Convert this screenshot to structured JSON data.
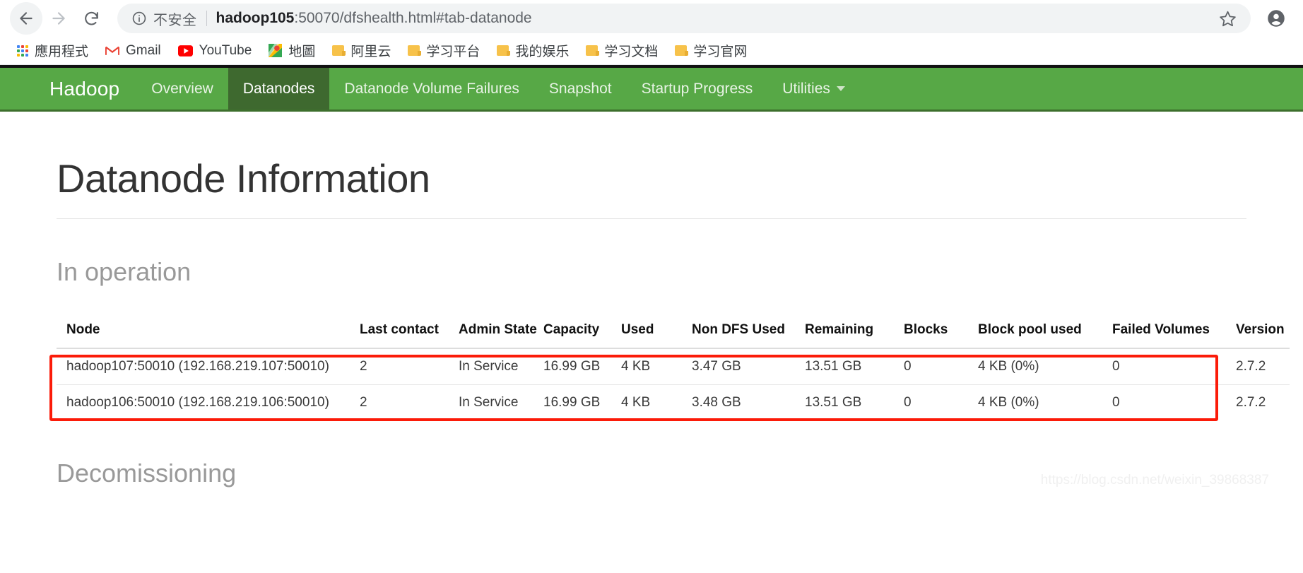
{
  "browser": {
    "back_icon": "arrow-left-icon",
    "forward_icon": "arrow-right-icon",
    "reload_icon": "reload-icon",
    "security_icon": "info-circle-icon",
    "security_label": "不安全",
    "url_host": "hadoop105",
    "url_rest": ":50070/dfshealth.html#tab-datanode",
    "star_icon": "star-icon",
    "profile_icon": "profile-avatar-icon",
    "bookmarks": [
      {
        "label": "應用程式",
        "icon": "apps-grid-icon"
      },
      {
        "label": "Gmail",
        "icon": "gmail-icon"
      },
      {
        "label": "YouTube",
        "icon": "youtube-icon"
      },
      {
        "label": "地圖",
        "icon": "google-maps-icon"
      },
      {
        "label": "阿里云",
        "icon": "folder-icon"
      },
      {
        "label": "学习平台",
        "icon": "folder-icon"
      },
      {
        "label": "我的娱乐",
        "icon": "folder-icon"
      },
      {
        "label": "学习文档",
        "icon": "folder-icon"
      },
      {
        "label": "学习官网",
        "icon": "folder-icon"
      }
    ]
  },
  "navbar": {
    "brand": "Hadoop",
    "accent_color": "#57a846",
    "active_color": "#3e692f",
    "items": [
      {
        "label": "Overview",
        "active": false
      },
      {
        "label": "Datanodes",
        "active": true
      },
      {
        "label": "Datanode Volume Failures",
        "active": false
      },
      {
        "label": "Snapshot",
        "active": false
      },
      {
        "label": "Startup Progress",
        "active": false
      },
      {
        "label": "Utilities",
        "active": false,
        "icon": "chevron-down-icon"
      }
    ]
  },
  "main": {
    "page_title": "Datanode Information",
    "in_operation_heading": "In operation",
    "decommissioning_heading": "Decomissioning",
    "highlight_color": "#fb1b09",
    "table": {
      "headers": [
        "Node",
        "Last contact",
        "Admin State",
        "Capacity",
        "Used",
        "Non DFS Used",
        "Remaining",
        "Blocks",
        "Block pool used",
        "Failed Volumes",
        "Version"
      ],
      "rows": [
        {
          "node": "hadoop107:50010 (192.168.219.107:50010)",
          "last_contact": "2",
          "admin_state": "In Service",
          "capacity": "16.99 GB",
          "used": "4 KB",
          "non_dfs_used": "3.47 GB",
          "remaining": "13.51 GB",
          "blocks": "0",
          "block_pool_used": "4 KB (0%)",
          "failed_volumes": "0",
          "version": "2.7.2"
        },
        {
          "node": "hadoop106:50010 (192.168.219.106:50010)",
          "last_contact": "2",
          "admin_state": "In Service",
          "capacity": "16.99 GB",
          "used": "4 KB",
          "non_dfs_used": "3.48 GB",
          "remaining": "13.51 GB",
          "blocks": "0",
          "block_pool_used": "4 KB (0%)",
          "failed_volumes": "0",
          "version": "2.7.2"
        }
      ]
    }
  },
  "watermark": "https://blog.csdn.net/weixin_39868387"
}
